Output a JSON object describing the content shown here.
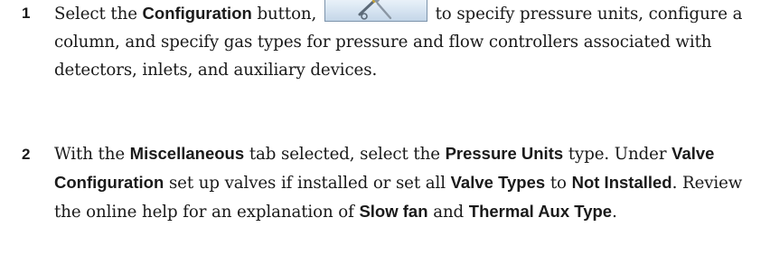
{
  "steps": [
    {
      "number": "1",
      "parts": {
        "p1": "Select the ",
        "k1": "Configuration",
        "p2": " button, ",
        "p3": " to specify pressure units, configure a column, and specify gas types for pressure and flow controllers associated with detectors, inlets, and auxiliary devices."
      },
      "button_icon": "wrench-screwdriver-icon"
    },
    {
      "number": "2",
      "parts": {
        "p1": "With the ",
        "k1": "Miscellaneous",
        "p2": " tab selected, select the ",
        "k2": "Pressure Units",
        "p3": " type. Under ",
        "k3": "Valve Configuration",
        "p4": " set up valves if installed or set all ",
        "k4": "Valve Types",
        "p5": " to ",
        "k5": "Not Installed",
        "p6": ". Review the online help for an explanation of ",
        "k6": "Slow fan",
        "p7": " and ",
        "k7": "Thermal Aux Type",
        "p8": "."
      }
    }
  ],
  "colors": {
    "text": "#1a1a1a",
    "button_top": "#ecf3fa",
    "button_bottom": "#c4d6e8",
    "button_border": "#7c93ab"
  }
}
